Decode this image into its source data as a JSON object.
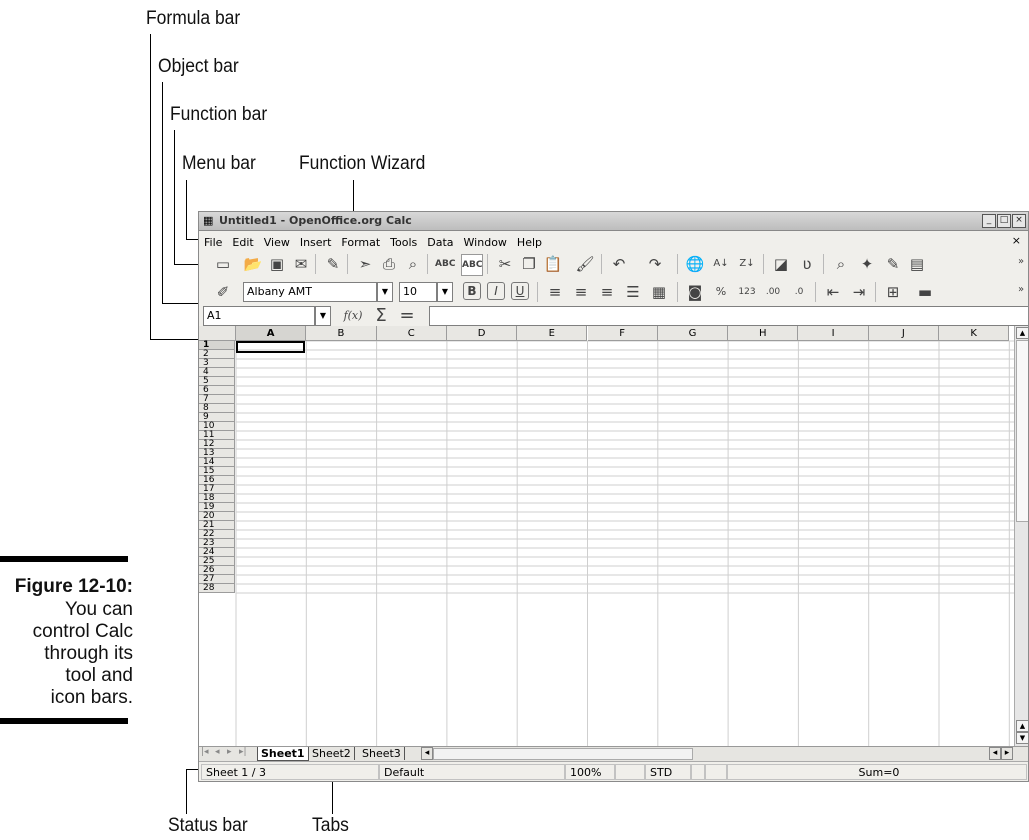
{
  "callouts": {
    "formula_bar": "Formula bar",
    "object_bar": "Object bar",
    "function_bar": "Function bar",
    "menu_bar": "Menu bar",
    "function_wizard": "Function Wizard",
    "status_bar": "Status bar",
    "tabs": "Tabs"
  },
  "figure": {
    "label": "Figure 12-10:",
    "caption_lines": [
      "You can",
      "control Calc",
      "through its",
      "tool and",
      "icon bars."
    ]
  },
  "window": {
    "title": "Untitled1 - OpenOffice.org Calc",
    "menu": [
      "File",
      "Edit",
      "View",
      "Insert",
      "Format",
      "Tools",
      "Data",
      "Window",
      "Help"
    ],
    "close_doc": "×"
  },
  "object_bar": {
    "font_name": "Albany AMT",
    "font_size": "10"
  },
  "formula_bar": {
    "cell_ref": "A1",
    "func_label": "f(x)",
    "sum_label": "Σ",
    "equals_label": "="
  },
  "sheet": {
    "columns": [
      "A",
      "B",
      "C",
      "D",
      "E",
      "F",
      "G",
      "H",
      "I",
      "J",
      "K"
    ],
    "rows": [
      "1",
      "2",
      "3",
      "4",
      "5",
      "6",
      "7",
      "8",
      "9",
      "10",
      "11",
      "12",
      "13",
      "14",
      "15",
      "16",
      "17",
      "18",
      "19",
      "20",
      "21",
      "22",
      "23",
      "24",
      "25",
      "26",
      "27",
      "28"
    ],
    "tabs": [
      "Sheet1",
      "Sheet2",
      "Sheet3"
    ]
  },
  "status": {
    "sheet_pos": "Sheet 1 / 3",
    "page_style": "Default",
    "zoom": "100%",
    "mode": "STD",
    "sum": "Sum=0"
  }
}
